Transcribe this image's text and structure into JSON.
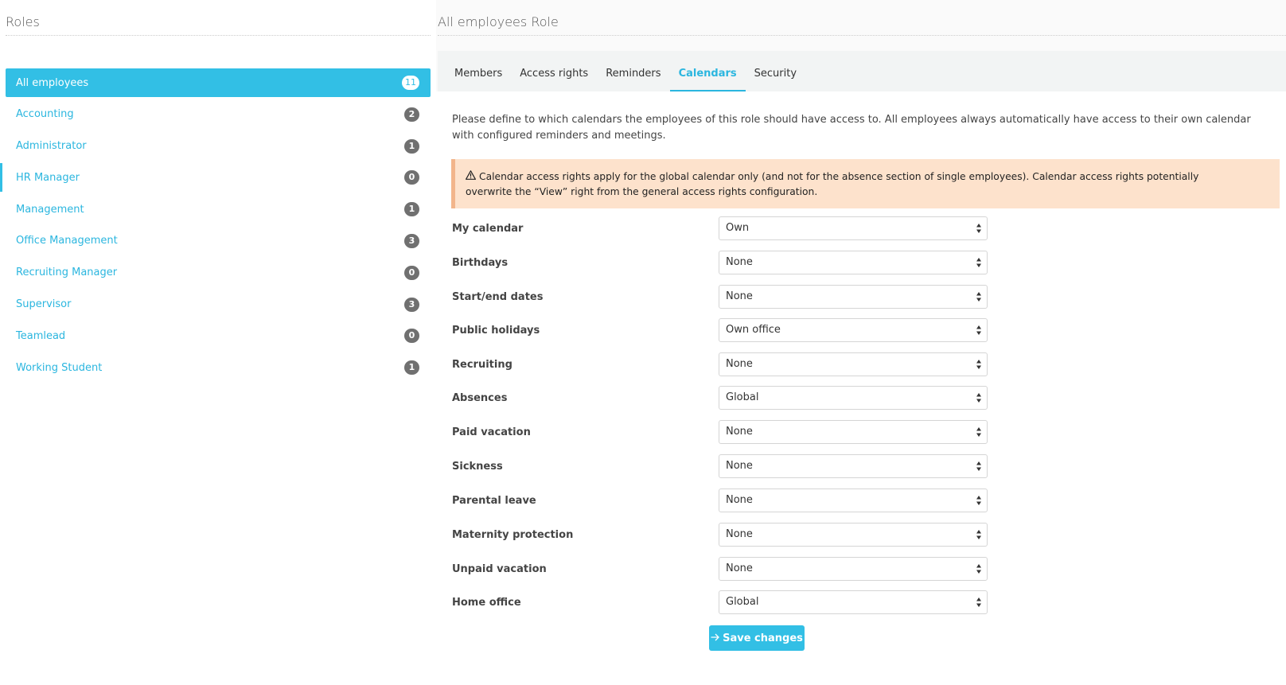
{
  "roles_panel": {
    "title": "Roles",
    "items": [
      {
        "label": "All employees",
        "count": "11"
      },
      {
        "label": "Accounting",
        "count": "2"
      },
      {
        "label": "Administrator",
        "count": "1"
      },
      {
        "label": "HR Manager",
        "count": "0"
      },
      {
        "label": "Management",
        "count": "1"
      },
      {
        "label": "Office Management",
        "count": "3"
      },
      {
        "label": "Recruiting Manager",
        "count": "0"
      },
      {
        "label": "Supervisor",
        "count": "3"
      },
      {
        "label": "Teamlead",
        "count": "0"
      },
      {
        "label": "Working Student",
        "count": "1"
      }
    ]
  },
  "detail": {
    "title": "All employees Role",
    "tabs": [
      {
        "label": "Members"
      },
      {
        "label": "Access rights"
      },
      {
        "label": "Reminders"
      },
      {
        "label": "Calendars"
      },
      {
        "label": "Security"
      }
    ],
    "active_tab": "Calendars",
    "intro": "Please define to which calendars the employees of this role should have access to. All employees always automatically have access to their own calendar with configured reminders and meetings.",
    "alert": "Calendar access rights apply for the global calendar only (and not for the absence section of single employees). Calendar access rights potentially overwrite the “View” right from the general access rights configuration.",
    "fields": [
      {
        "label": "My calendar",
        "value": "Own"
      },
      {
        "label": "Birthdays",
        "value": "None"
      },
      {
        "label": "Start/end dates",
        "value": "None"
      },
      {
        "label": "Public holidays",
        "value": "Own office"
      },
      {
        "label": "Recruiting",
        "value": "None"
      },
      {
        "label": "Absences",
        "value": "Global"
      },
      {
        "label": "Paid vacation",
        "value": "None"
      },
      {
        "label": "Sickness",
        "value": "None"
      },
      {
        "label": "Parental leave",
        "value": "None"
      },
      {
        "label": "Maternity protection",
        "value": "None"
      },
      {
        "label": "Unpaid vacation",
        "value": "None"
      },
      {
        "label": "Home office",
        "value": "Global"
      }
    ],
    "save_label": "Save changes"
  },
  "colors": {
    "accent": "#32bfe5",
    "badge": "#707070",
    "alert_bg": "#fde2cc",
    "alert_border": "#f2b58b"
  },
  "icons": {
    "alert": "warning-triangle-icon",
    "save": "arrow-right-icon",
    "select": "select-arrows-icon"
  }
}
